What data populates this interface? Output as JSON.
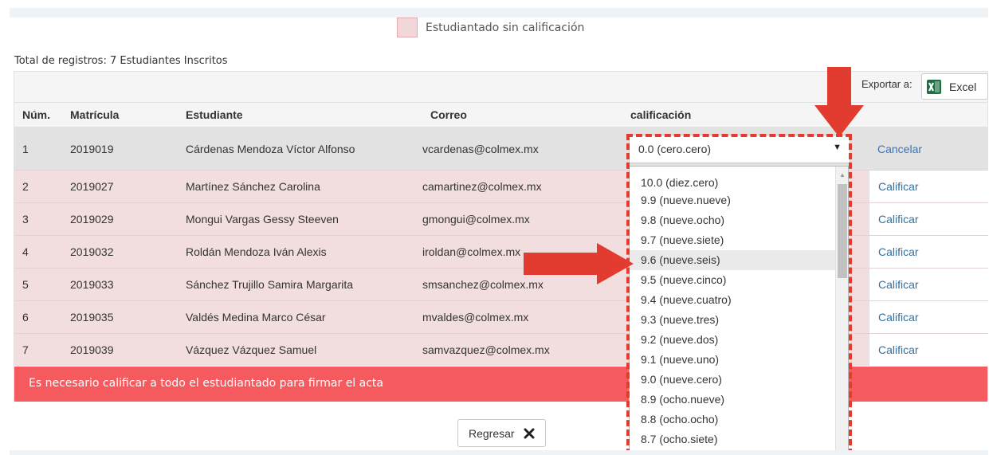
{
  "legend": {
    "label": "Estudiantado sin calificación",
    "color": "#f2d7da"
  },
  "summary": {
    "total": "Total de registros: 7 Estudiantes Inscritos"
  },
  "toolbar": {
    "export_label": "Exportar a:",
    "excel_label": "Excel",
    "excel_icon": "excel-icon"
  },
  "table": {
    "headers": {
      "num": "Núm.",
      "matricula": "Matrícula",
      "estudiante": "Estudiante",
      "correo": "Correo",
      "calificacion": "calificación"
    },
    "rows": [
      {
        "num": "1",
        "matricula": "2019019",
        "estudiante": "Cárdenas Mendoza Víctor Alfonso",
        "correo": "vcardenas@colmex.mx",
        "action": "Cancelar"
      },
      {
        "num": "2",
        "matricula": "2019027",
        "estudiante": "Martínez Sánchez Carolina",
        "correo": "camartinez@colmex.mx",
        "action": "Calificar"
      },
      {
        "num": "3",
        "matricula": "2019029",
        "estudiante": "Mongui Vargas Gessy Steeven",
        "correo": "gmongui@colmex.mx",
        "action": "Calificar"
      },
      {
        "num": "4",
        "matricula": "2019032",
        "estudiante": "Roldán Mendoza Iván Alexis",
        "correo": "iroldan@colmex.mx",
        "action": "Calificar"
      },
      {
        "num": "5",
        "matricula": "2019033",
        "estudiante": "Sánchez Trujillo Samira Margarita",
        "correo": "smsanchez@colmex.mx",
        "action": "Calificar"
      },
      {
        "num": "6",
        "matricula": "2019035",
        "estudiante": "Valdés Medina Marco César",
        "correo": "mvaldes@colmex.mx",
        "action": "Calificar"
      },
      {
        "num": "7",
        "matricula": "2019039",
        "estudiante": "Vázquez Vázquez Samuel",
        "correo": "samvazquez@colmex.mx",
        "action": "Calificar"
      }
    ]
  },
  "select": {
    "value": "0.0 (cero.cero)",
    "options": [
      "10.0 (diez.cero)",
      "9.9 (nueve.nueve)",
      "9.8 (nueve.ocho)",
      "9.7 (nueve.siete)",
      "9.6 (nueve.seis)",
      "9.5 (nueve.cinco)",
      "9.4 (nueve.cuatro)",
      "9.3 (nueve.tres)",
      "9.2 (nueve.dos)",
      "9.1 (nueve.uno)",
      "9.0 (nueve.cero)",
      "8.9 (ocho.nueve)",
      "8.8 (ocho.ocho)",
      "8.7 (ocho.siete)"
    ],
    "highlighted": "9.6 (nueve.seis)"
  },
  "alert": {
    "message": "Es necesario calificar a todo el estudiantado para firmar el acta",
    "color": "#f55a5e"
  },
  "footer": {
    "back_label": "Regresar"
  },
  "annotations": {
    "color": "#e23b30"
  }
}
